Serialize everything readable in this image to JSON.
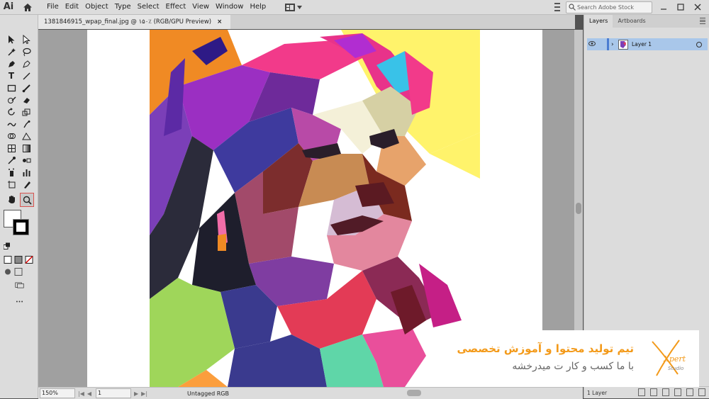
{
  "app": {
    "logo": "Ai"
  },
  "menu": {
    "items": [
      "File",
      "Edit",
      "Object",
      "Type",
      "Select",
      "Effect",
      "View",
      "Window",
      "Help"
    ]
  },
  "search": {
    "placeholder": "Search Adobe Stock"
  },
  "document": {
    "tab_title": "1381846915_wpap_final.jpg @ ۱۵۰٪ (RGB/GPU Preview)",
    "close": "×"
  },
  "status": {
    "zoom": "150%",
    "page": "1",
    "profile": "Untagged RGB"
  },
  "panel": {
    "tabs": [
      "Layers",
      "Artboards"
    ],
    "layer_name": "Layer 1",
    "layer_count": "1 Layer"
  },
  "watermark": {
    "line1": "تیم تولید محتوا و آموزش تخصصی",
    "line2": "با ما کسب و کار ت میدرخشه",
    "logo_text": "Xpert",
    "logo_sub": "Studio"
  },
  "icons": [
    "home-icon",
    "workspace-icon",
    "search-icon",
    "minimize-icon",
    "maximize-icon",
    "close-icon",
    "eye-icon",
    "chevron-right-icon",
    "zoom-icon"
  ],
  "colors": {
    "selection": "#a9c7ea",
    "accent": "#f39a1a",
    "layer": "#4a7cd1"
  }
}
